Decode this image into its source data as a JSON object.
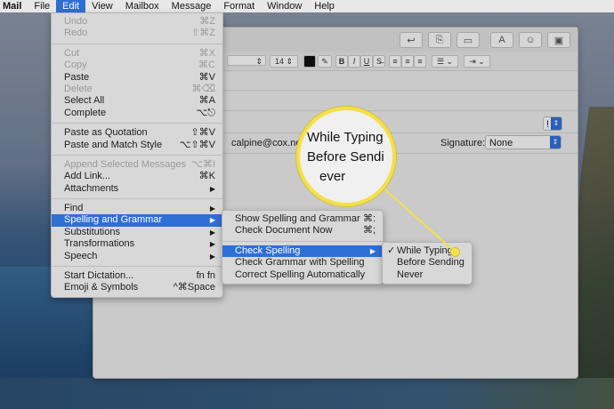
{
  "menubar": {
    "items": [
      "Mail",
      "File",
      "Edit",
      "View",
      "Mailbox",
      "Message",
      "Format",
      "Window",
      "Help"
    ],
    "active": "Edit"
  },
  "edit_menu": {
    "groups": [
      [
        {
          "label": "Undo",
          "shortcut": "⌘Z",
          "disabled": true
        },
        {
          "label": "Redo",
          "shortcut": "⇧⌘Z",
          "disabled": true
        }
      ],
      [
        {
          "label": "Cut",
          "shortcut": "⌘X",
          "disabled": true
        },
        {
          "label": "Copy",
          "shortcut": "⌘C",
          "disabled": true
        },
        {
          "label": "Paste",
          "shortcut": "⌘V",
          "disabled": false
        },
        {
          "label": "Delete",
          "shortcut": "⌘⌫",
          "disabled": true
        },
        {
          "label": "Select All",
          "shortcut": "⌘A",
          "disabled": false
        },
        {
          "label": "Complete",
          "shortcut": "⌥⎋",
          "disabled": false
        }
      ],
      [
        {
          "label": "Paste as Quotation",
          "shortcut": "⇧⌘V",
          "disabled": false
        },
        {
          "label": "Paste and Match Style",
          "shortcut": "⌥⇧⌘V",
          "disabled": false
        }
      ],
      [
        {
          "label": "Append Selected Messages",
          "shortcut": "⌥⌘I",
          "disabled": true
        },
        {
          "label": "Add Link...",
          "shortcut": "⌘K",
          "disabled": false
        },
        {
          "label": "Attachments",
          "submenu": true,
          "disabled": false
        }
      ],
      [
        {
          "label": "Find",
          "submenu": true,
          "disabled": false
        },
        {
          "label": "Spelling and Grammar",
          "submenu": true,
          "disabled": false,
          "highlighted": true
        },
        {
          "label": "Substitutions",
          "submenu": true,
          "disabled": false
        },
        {
          "label": "Transformations",
          "submenu": true,
          "disabled": false
        },
        {
          "label": "Speech",
          "submenu": true,
          "disabled": false
        }
      ],
      [
        {
          "label": "Start Dictation...",
          "shortcut": "fn fn",
          "disabled": false
        },
        {
          "label": "Emoji & Symbols",
          "shortcut": "^⌘Space",
          "disabled": false
        }
      ]
    ]
  },
  "spelling_menu": {
    "groups": [
      [
        {
          "label": "Show Spelling and Grammar",
          "shortcut": "⌘:"
        },
        {
          "label": "Check Document Now",
          "shortcut": "⌘;"
        }
      ],
      [
        {
          "label": "Check Spelling",
          "submenu": true,
          "highlighted": true
        },
        {
          "label": "Check Grammar with Spelling"
        },
        {
          "label": "Correct Spelling Automatically"
        }
      ]
    ]
  },
  "check_spelling_menu": {
    "items": [
      {
        "label": "While Typing",
        "checked": true
      },
      {
        "label": "Before Sending",
        "checked": false
      },
      {
        "label": "Never",
        "checked": false
      }
    ]
  },
  "compose": {
    "from_partial": "calpine@cox.net",
    "signature_label": "Signature:",
    "signature_value": "None",
    "font_size": "14",
    "priority_glyph": "!"
  },
  "magnifier": {
    "lines": [
      "While Typing",
      "Before Sendi",
      "ever"
    ]
  },
  "colors": {
    "highlight": "#2f6fd6",
    "callout": "#f4e04a"
  }
}
